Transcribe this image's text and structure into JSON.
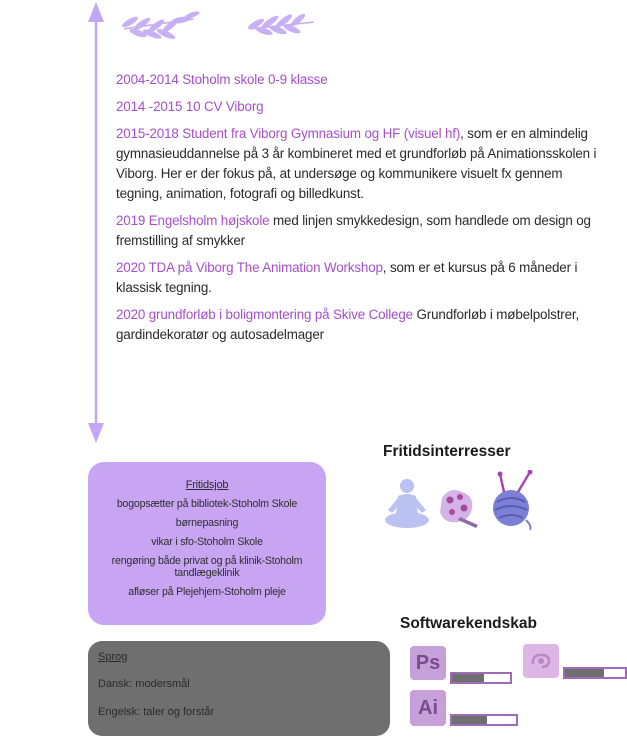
{
  "education": [
    {
      "highlight": "2004-2014 Stoholm skole 0-9 klasse",
      "rest": ""
    },
    {
      "highlight": "2014 -2015 10 CV Viborg",
      "rest": ""
    },
    {
      "highlight": "2015-2018 Student fra Viborg Gymnasium og HF (visuel hf)",
      "rest": ", som er en almindelig gymnasieuddannelse på 3 år kombineret med et grundforløb på Animationsskolen i Viborg. Her er der fokus på, at undersøge og kommunikere visuelt fx gennem tegning, animation, fotografi og billedkunst."
    },
    {
      "highlight": "2019 Engelsholm højskole",
      "rest": " med linjen smykkedesign, som handlede om design og fremstilling af smykker"
    },
    {
      "highlight": "2020 TDA på Viborg The Animation Workshop",
      "rest": ", som er et kursus på 6 måneder i klassisk tegning."
    },
    {
      "highlight": "2020 grundforløb i boligmontering på Skive College",
      "rest": " Grundforløb i møbelpolstrer, gardindekoratør og autosadelmager"
    }
  ],
  "fritidsjob": {
    "title": "Fritidsjob",
    "items": [
      "bogopsætter på bibliotek-Stoholm Skole",
      "børnepasning",
      "vikar i sfo-Stoholm Skole",
      "rengøring både privat og på klinik-Stoholm tandlægeklinik",
      "afløser på Plejehjem-Stoholm pleje"
    ]
  },
  "sprog": {
    "title": "Sprog",
    "lines": [
      "Dansk: modersmål",
      "Engelsk: taler og forstår"
    ]
  },
  "fritid": {
    "heading": "Fritidsinterresser",
    "icons": [
      "meditation-icon",
      "painting-icon",
      "yarn-icon"
    ]
  },
  "software": {
    "heading": "Softwarekendskab",
    "items": [
      {
        "label": "Ps",
        "icon": "photoshop-icon",
        "level": 0.55
      },
      {
        "label": "",
        "icon": "procreate-icon",
        "level": 0.65
      },
      {
        "label": "Ai",
        "icon": "illustrator-icon",
        "level": 0.55
      }
    ]
  },
  "colors": {
    "accent": "#a64fc9",
    "timeline": "#c3a6f7",
    "box_purple": "#c8a5f2",
    "box_gray": "#6f6f6f"
  }
}
